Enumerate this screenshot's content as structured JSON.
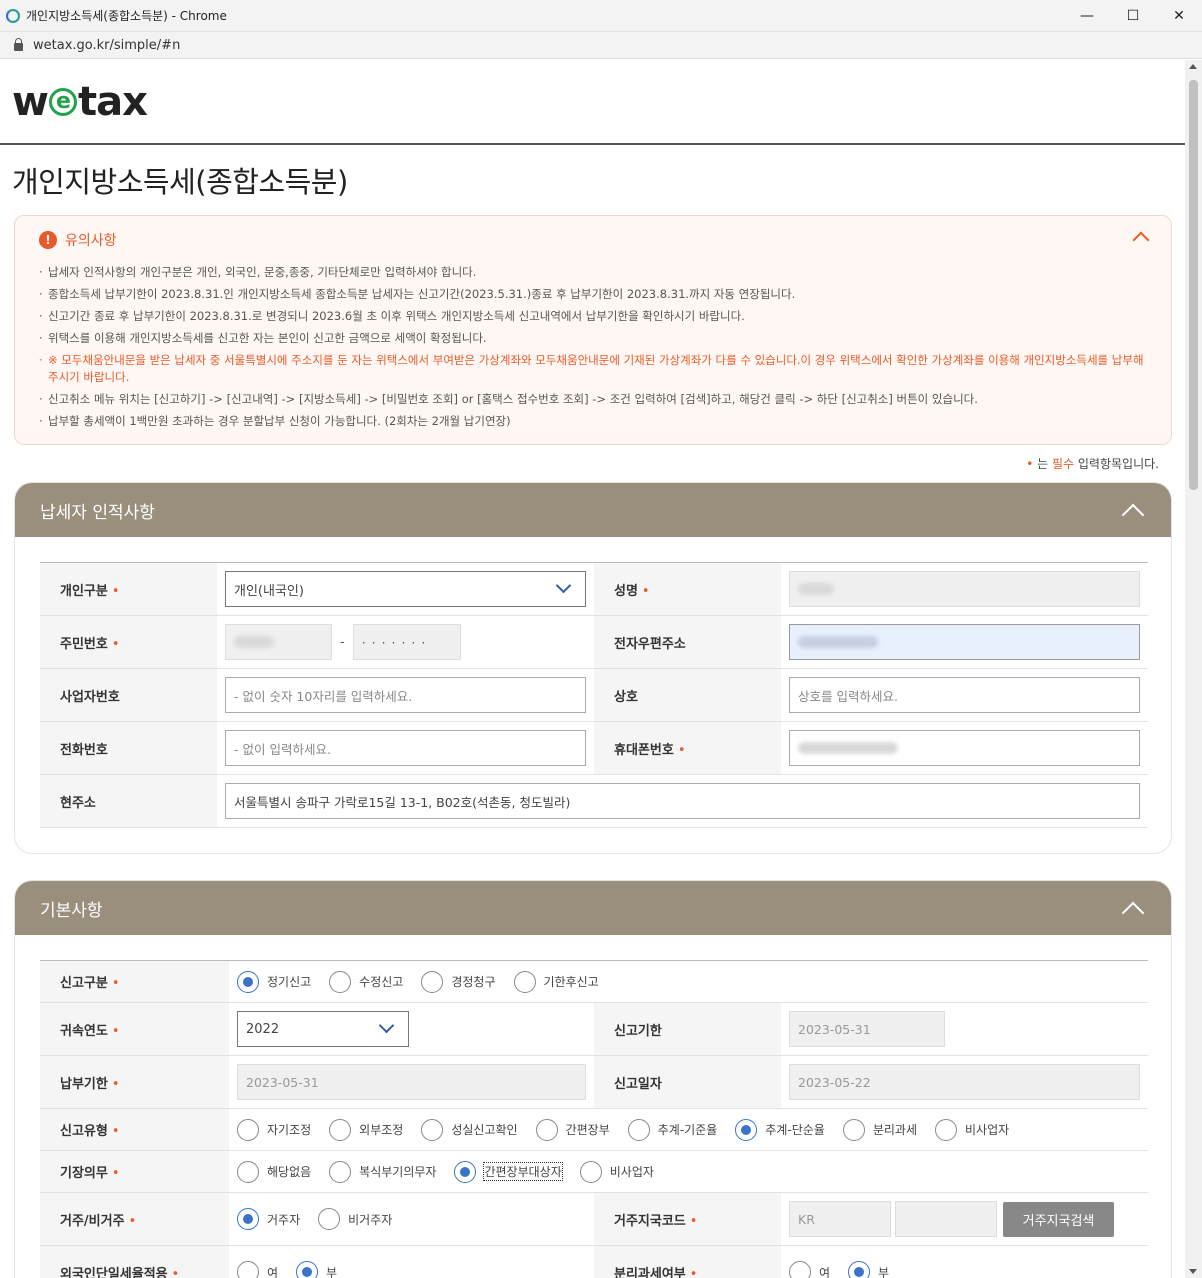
{
  "browser": {
    "title": "개인지방소득세(종합소득분) - Chrome",
    "url": "wetax.go.kr/simple/#n",
    "minimize": "—",
    "maximize": "☐",
    "close": "✕"
  },
  "logo": {
    "part1": "w",
    "part2": "e",
    "part3": "tax"
  },
  "page_title": "개인지방소득세(종합소득분)",
  "notice": {
    "title": "유의사항",
    "items": [
      "납세자 인적사항의 개인구분은 개인, 외국인, 문중,종중, 기타단체로만 입력하셔야 합니다.",
      "종합소득세 납부기한이 2023.8.31.인 개인지방소득세 종합소득분 납세자는 신고기간(2023.5.31.)종료 후 납부기한이 2023.8.31.까지 자동 연장됩니다.",
      "신고기간 종료 후 납부기한이 2023.8.31.로 변경되니 2023.6월 초 이후 위택스 개인지방소득세 신고내역에서 납부기한을 확인하시기 바랍니다.",
      "위택스를 이용해 개인지방소득세를 신고한 자는 본인이 신고한 금액으로 세액이 확정됩니다.",
      "※ 모두채움안내문을 받은 납세자 중 서울특별시에 주소지를 둔 자는 위택스에서 부여받은 가상계좌와 모두채움안내문에 기재된 가상계좌가 다를 수 있습니다.이 경우 위택스에서 확인한 가상계좌를 이용해 개인지방소득세를 납부해 주시기 바랍니다.",
      "신고취소 메뉴 위치는 [신고하기] -> [신고내역] -> [지방소득세] -> [비밀번호 조회] or [홈택스 접수번호 조회] -> 조건 입력하여 [검색]하고, 해당건 클릭 -> 하단 [신고취소] 버튼이 있습니다.",
      "납부할 총세액이 1백만원 초과하는 경우 분할납부 신청이 가능합니다. (2회차는 2개월 납기연장)"
    ]
  },
  "required_note": {
    "dot": "•",
    "pre": " 는 ",
    "bold": "필수",
    "post": " 입력항목입니다."
  },
  "taxpayer": {
    "title": "납세자 인적사항",
    "req_mark": "•",
    "labels": {
      "type": "개인구분",
      "name": "성명",
      "rrn": "주민번호",
      "email": "전자우편주소",
      "bizno": "사업자번호",
      "company": "상호",
      "phone": "전화번호",
      "mobile": "휴대폰번호",
      "address": "현주소"
    },
    "type_value": "개인(내국인)",
    "rrn_sep": "-",
    "rrn_back": "· · · · · · ·",
    "bizno_placeholder": "- 없이 숫자 10자리를 입력하세요.",
    "company_placeholder": "상호를 입력하세요.",
    "phone_placeholder": "- 없이 입력하세요.",
    "address_value": "서울특별시 송파구 가락로15길 13-1, B02호(석촌동, 청도빌라)"
  },
  "basic": {
    "title": "기본사항",
    "labels": {
      "report_type": "신고구분",
      "year": "귀속연도",
      "report_deadline": "신고기한",
      "pay_deadline": "납부기한",
      "report_date": "신고일자",
      "report_kind": "신고유형",
      "bookkeeping": "기장의무",
      "residency": "거주/비거주",
      "residence_code": "거주지국코드",
      "foreign_flat": "외국인단일세율적용",
      "separate_tax": "분리과세여부"
    },
    "report_type_options": [
      "정기신고",
      "수정신고",
      "경정청구",
      "기한후신고"
    ],
    "year_value": "2022",
    "report_deadline_value": "2023-05-31",
    "pay_deadline_value": "2023-05-31",
    "report_date_value": "2023-05-22",
    "report_kind_options": [
      "자기조정",
      "외부조정",
      "성실신고확인",
      "간편장부",
      "추계-기준율",
      "추계-단순율",
      "분리과세",
      "비사업자"
    ],
    "bookkeeping_options": [
      "해당없음",
      "복식부기의무자",
      "간편장부대상자",
      "비사업자"
    ],
    "residency_options": [
      "거주자",
      "비거주자"
    ],
    "residence_code_value": "KR",
    "residence_search_button": "거주지국검색",
    "yes": "여",
    "no": "부"
  }
}
